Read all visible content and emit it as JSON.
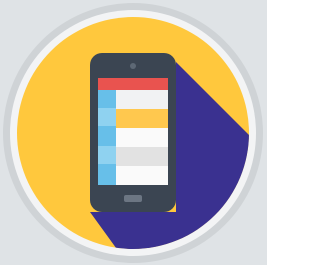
{
  "icon": {
    "name": "mobile-phone-app-icon",
    "depicts": "smartphone-icon"
  },
  "colors": {
    "background": "#dfe3e6",
    "rim_outer": "#cfd3d6",
    "rim_inner": "#f3f4f5",
    "circle_fill": "#ffc83d",
    "long_shadow": "#3a3190",
    "phone_body": "#3b4552",
    "phone_top": "#2f3742",
    "camera": "#5d6875",
    "home_button": "#6c7683",
    "status_bar": "#e9534f",
    "sidebar": "#67bfe9",
    "sidebar_alt": "#8fd2f0",
    "row_light": "#f1f2f3",
    "row_white": "#fafafa",
    "row_highlight": "#ffc84e",
    "row_gray": "#e2e2e2"
  }
}
